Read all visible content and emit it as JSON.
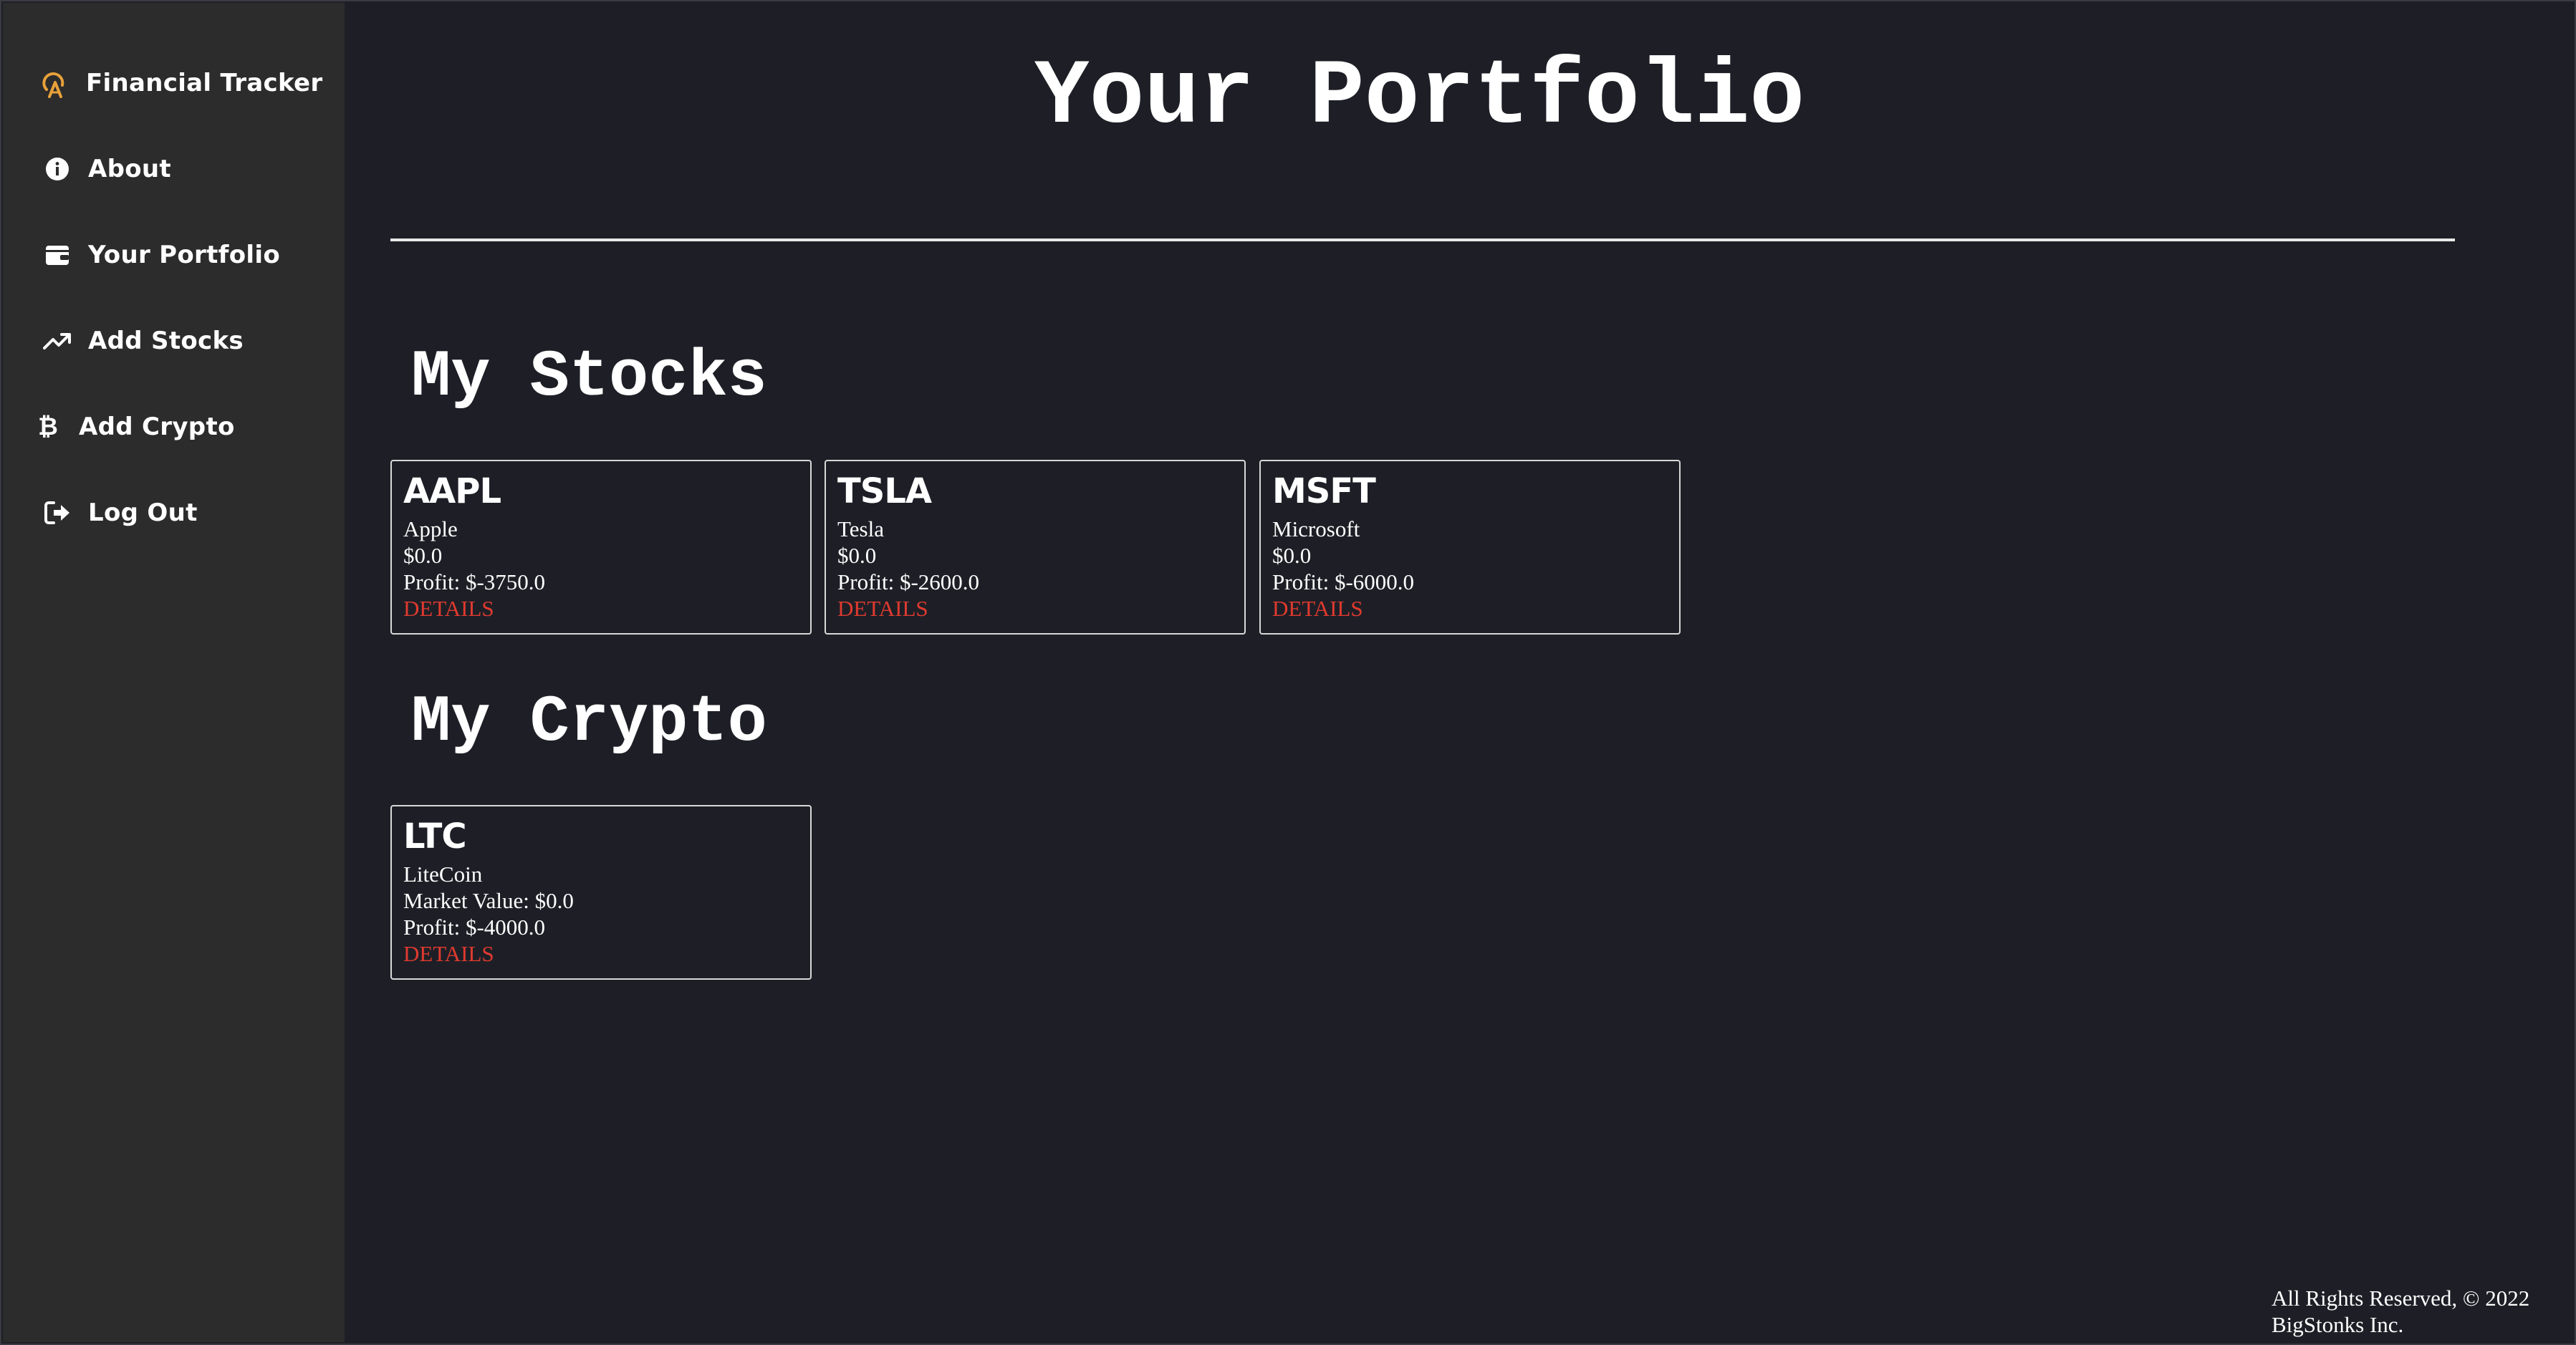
{
  "sidebar": {
    "items": [
      {
        "label": "Financial Tracker",
        "icon": "logo-icon"
      },
      {
        "label": "About",
        "icon": "info-icon"
      },
      {
        "label": "Your Portfolio",
        "icon": "wallet-icon"
      },
      {
        "label": "Add Stocks",
        "icon": "trending-up-icon"
      },
      {
        "label": "Add Crypto",
        "icon": "bitcoin-icon"
      },
      {
        "label": "Log Out",
        "icon": "log-out-icon"
      }
    ]
  },
  "colors": {
    "background": "#1e1f26",
    "sidebar": "#2c2c2c",
    "accent_logo": "#e8a13a",
    "details_link": "#e03a2f"
  },
  "main": {
    "title": "Your Portfolio",
    "stocks_section": {
      "title": "My Stocks",
      "cards": [
        {
          "ticker": "AAPL",
          "name": "Apple",
          "value": "$0.0",
          "profit": "Profit: $-3750.0",
          "link": "DETAILS"
        },
        {
          "ticker": "TSLA",
          "name": "Tesla",
          "value": "$0.0",
          "profit": "Profit: $-2600.0",
          "link": "DETAILS"
        },
        {
          "ticker": "MSFT",
          "name": "Microsoft",
          "value": "$0.0",
          "profit": "Profit: $-6000.0",
          "link": "DETAILS"
        }
      ]
    },
    "crypto_section": {
      "title": "My Crypto",
      "cards": [
        {
          "ticker": "LTC",
          "name": "LiteCoin",
          "value": "Market Value: $0.0",
          "profit": "Profit: $-4000.0",
          "link": "DETAILS"
        }
      ]
    }
  },
  "footer": {
    "line1": "All Rights Reserved, © 2022",
    "line2": "BigStonks Inc."
  }
}
